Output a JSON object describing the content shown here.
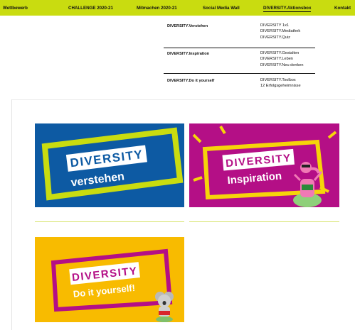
{
  "nav": {
    "items": [
      {
        "label": "Wettbewerb"
      },
      {
        "label": "CHALLENGE 2020-21"
      },
      {
        "label": "Mitmachen 2020-21"
      },
      {
        "label": "Social Media Wall"
      },
      {
        "label": "DIVERSITY.Aktionsbox"
      },
      {
        "label": "Kontakt"
      }
    ]
  },
  "dropdown": {
    "rows": [
      {
        "category": "DIVERSITY.Verstehen",
        "links": [
          "DIVERSITY 1x1",
          "DIVERSITY.Mediathek",
          "DIVERSITY.Quiz"
        ]
      },
      {
        "category": "DIVERSITY.Inspiration",
        "links": [
          "DIVERSITY.Gestalten",
          "DIVERSITY.Leben",
          "DIVERSITY.Neu denken"
        ]
      },
      {
        "category": "DIVERSITY.Do it yourself",
        "links": [
          "DIVERSITY.Toolbox",
          "12 Erfolgsgeheimnisse"
        ]
      }
    ]
  },
  "tiles": [
    {
      "logo": "DIVERSITY",
      "subtitle": "verstehen",
      "background": "#0d5aa3",
      "frame_color": "#c9dc10"
    },
    {
      "logo": "DIVERSITY",
      "subtitle": "Inspiration",
      "background": "#b40f86",
      "frame_color": "#f6d40a"
    },
    {
      "logo": "DIVERSITY",
      "subtitle": "Do it yourself!",
      "background": "#f8bb00",
      "frame_color": "#b40f86"
    }
  ],
  "colors": {
    "nav_bg": "#c9dc10",
    "accent_green": "#c9dc10",
    "blue": "#0d5aa3",
    "magenta": "#b40f86",
    "yellow": "#f8bb00"
  }
}
